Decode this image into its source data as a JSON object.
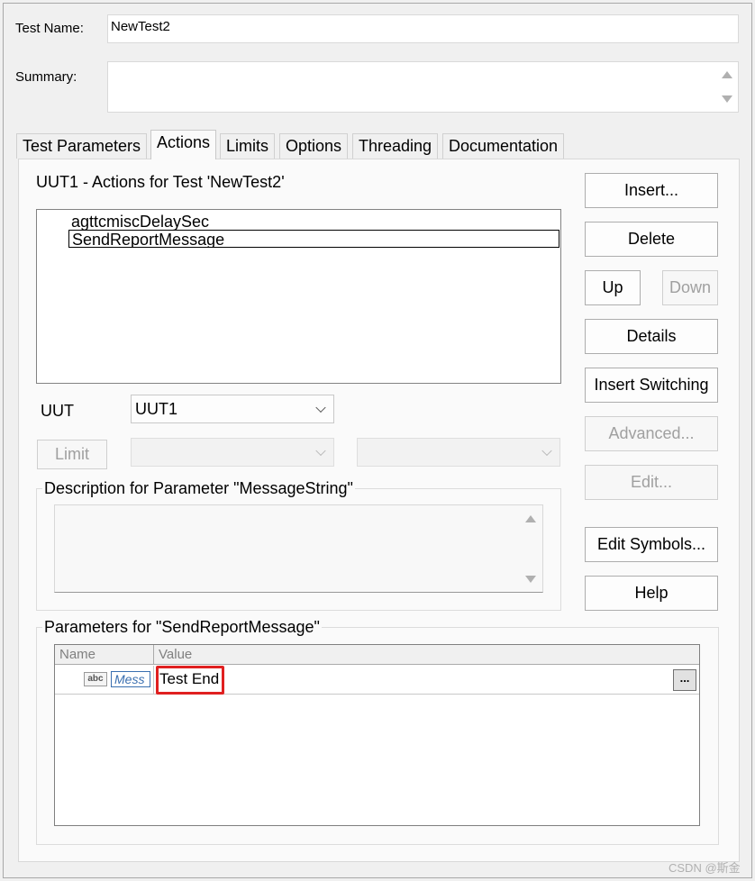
{
  "test_name": {
    "label": "Test Name:",
    "value": "NewTest2"
  },
  "summary": {
    "label": "Summary:",
    "value": ""
  },
  "tabs": [
    {
      "label": "Test Parameters"
    },
    {
      "label": "Actions"
    },
    {
      "label": "Limits"
    },
    {
      "label": "Options"
    },
    {
      "label": "Threading"
    },
    {
      "label": "Documentation"
    }
  ],
  "actions": {
    "heading": "UUT1 - Actions for Test 'NewTest2'",
    "items": [
      "agttcmiscDelaySec",
      "SendReportMessage"
    ],
    "selected_index": 1
  },
  "uut": {
    "label": "UUT",
    "value": "UUT1"
  },
  "limit_button": "Limit",
  "description": {
    "title": "Description for Parameter \"MessageString\"",
    "text": ""
  },
  "parameters": {
    "title": "Parameters for \"SendReportMessage\"",
    "columns": [
      "Name",
      "Value"
    ],
    "rows": [
      {
        "type_badge": "abc",
        "name": "Mess",
        "value": "Test End",
        "browse": "..."
      }
    ],
    "highlight_color": "#e02020"
  },
  "buttons": {
    "insert": "Insert...",
    "delete": "Delete",
    "up": "Up",
    "down": "Down",
    "details": "Details",
    "insert_switching": "Insert Switching",
    "advanced": "Advanced...",
    "edit": "Edit...",
    "edit_symbols": "Edit Symbols...",
    "help": "Help"
  },
  "watermark": "CSDN @斯金"
}
